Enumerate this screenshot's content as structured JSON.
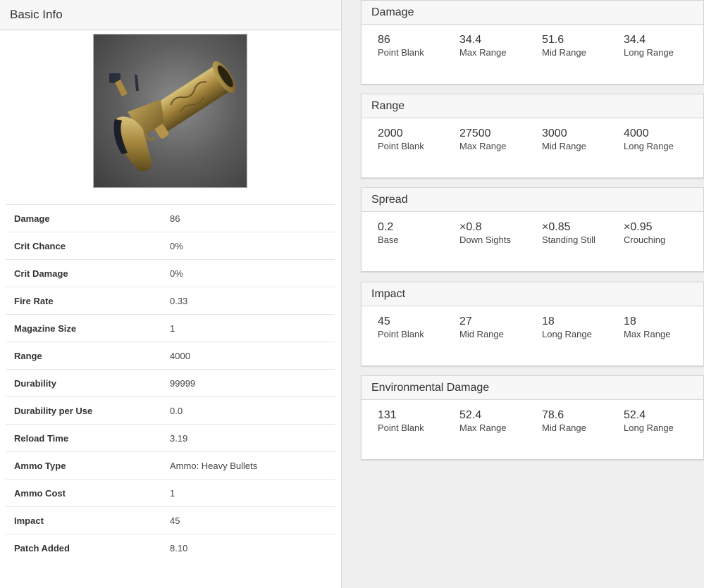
{
  "basic_info": {
    "title": "Basic Info",
    "image_alt": "Flint-Knock Pistol",
    "rows": [
      {
        "label": "Damage",
        "value": "86"
      },
      {
        "label": "Crit Chance",
        "value": "0%"
      },
      {
        "label": "Crit Damage",
        "value": "0%"
      },
      {
        "label": "Fire Rate",
        "value": "0.33"
      },
      {
        "label": "Magazine Size",
        "value": "1"
      },
      {
        "label": "Range",
        "value": "4000"
      },
      {
        "label": "Durability",
        "value": "99999"
      },
      {
        "label": "Durability per Use",
        "value": "0.0"
      },
      {
        "label": "Reload Time",
        "value": "3.19"
      },
      {
        "label": "Ammo Type",
        "value": "Ammo: Heavy Bullets"
      },
      {
        "label": "Ammo Cost",
        "value": "1"
      },
      {
        "label": "Impact",
        "value": "45"
      },
      {
        "label": "Patch Added",
        "value": "8.10"
      }
    ]
  },
  "cards": [
    {
      "title": "Damage",
      "stats": [
        {
          "value": "86",
          "label": "Point Blank"
        },
        {
          "value": "34.4",
          "label": "Max Range"
        },
        {
          "value": "51.6",
          "label": "Mid Range"
        },
        {
          "value": "34.4",
          "label": "Long Range"
        }
      ]
    },
    {
      "title": "Range",
      "stats": [
        {
          "value": "2000",
          "label": "Point Blank"
        },
        {
          "value": "27500",
          "label": "Max Range"
        },
        {
          "value": "3000",
          "label": "Mid Range"
        },
        {
          "value": "4000",
          "label": "Long Range"
        }
      ]
    },
    {
      "title": "Spread",
      "stats": [
        {
          "value": "0.2",
          "label": "Base"
        },
        {
          "value": "×0.8",
          "label": "Down Sights"
        },
        {
          "value": "×0.85",
          "label": "Standing Still"
        },
        {
          "value": "×0.95",
          "label": "Crouching"
        }
      ]
    },
    {
      "title": "Impact",
      "stats": [
        {
          "value": "45",
          "label": "Point Blank"
        },
        {
          "value": "27",
          "label": "Mid Range"
        },
        {
          "value": "18",
          "label": "Long Range"
        },
        {
          "value": "18",
          "label": "Max Range"
        }
      ]
    },
    {
      "title": "Environmental Damage",
      "stats": [
        {
          "value": "131",
          "label": "Point Blank"
        },
        {
          "value": "52.4",
          "label": "Max Range"
        },
        {
          "value": "78.6",
          "label": "Mid Range"
        },
        {
          "value": "52.4",
          "label": "Long Range"
        }
      ]
    }
  ]
}
